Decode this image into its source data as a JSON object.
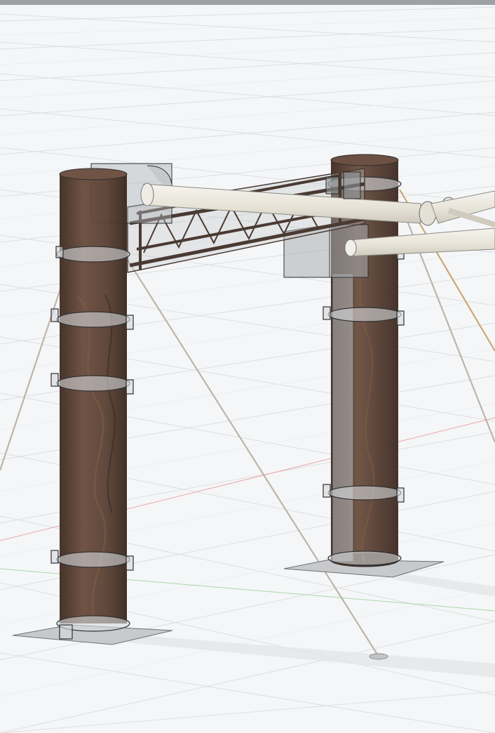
{
  "viewport": {
    "background": "#f5f6f7",
    "grid_color": "#d9dcdf",
    "axis_x_color": "#e8a0a0",
    "axis_y_color": "#9fd39f"
  },
  "model": {
    "post_wood_color": "#5e4538",
    "post_wood_dark": "#3f2c22",
    "bracket_color": "#b9bec2",
    "truss_color": "#4a3a33",
    "pipe_color": "#ece9df",
    "cable_color": "#bdb5a8",
    "baseplate_color": "#c7c9cb",
    "icons": [
      "left-post",
      "right-post",
      "truss-beam",
      "pipe",
      "guy-cable",
      "base-plate",
      "ground-anchor"
    ]
  }
}
